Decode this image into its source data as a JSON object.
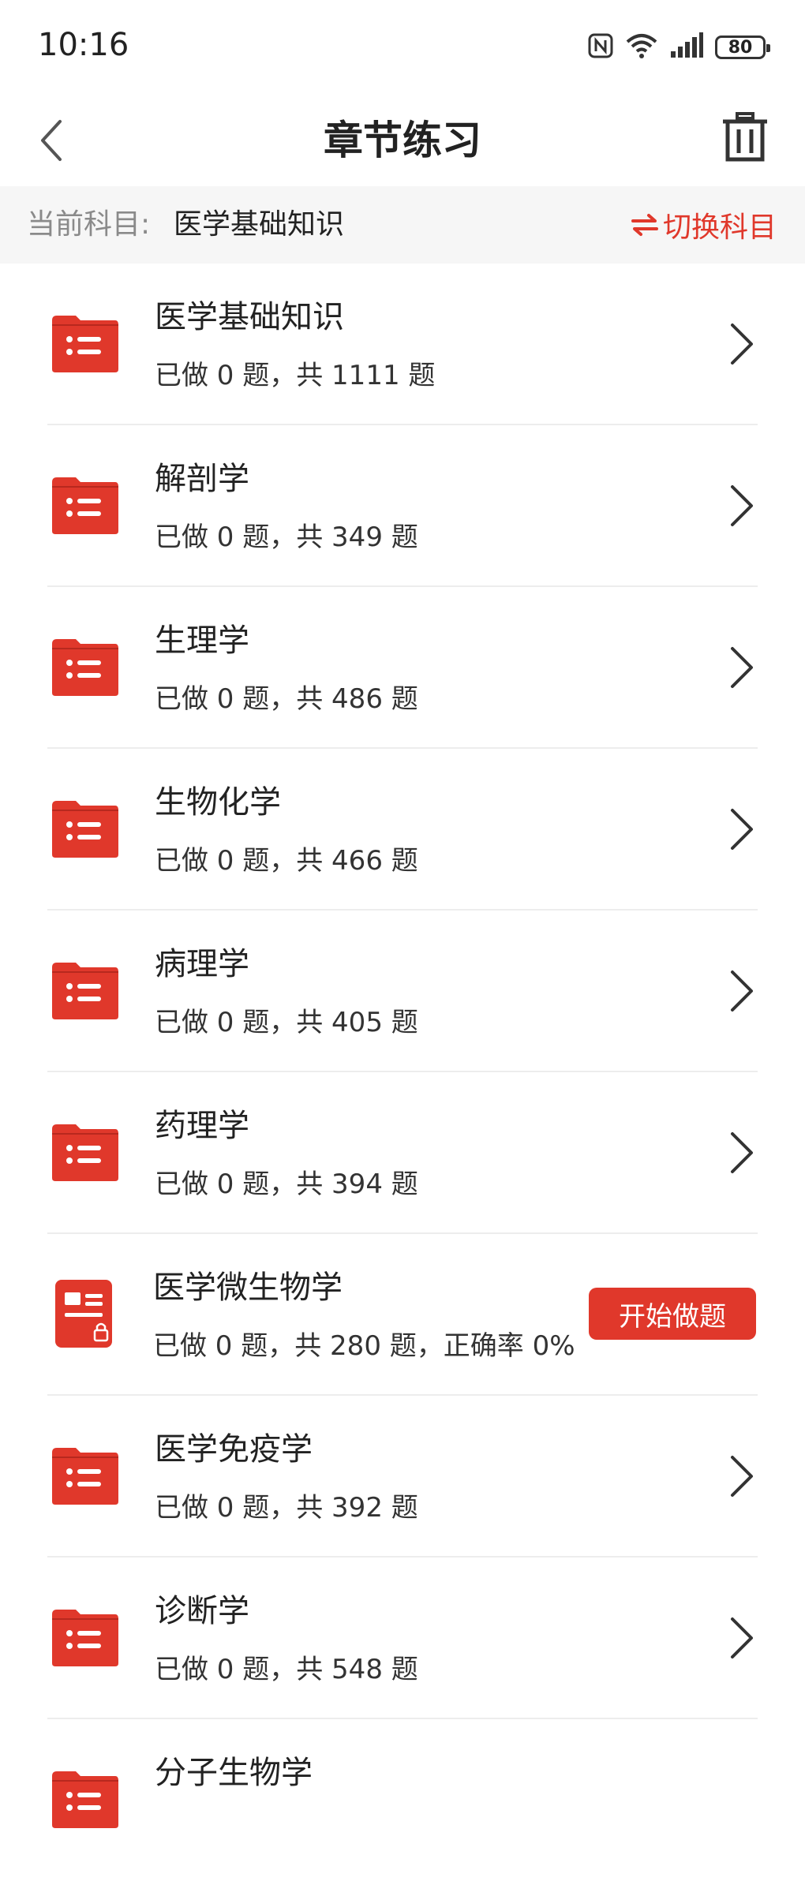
{
  "status_bar": {
    "time": "10:16",
    "battery": "80",
    "icons": [
      "nfc-icon",
      "wifi-icon",
      "signal-icon",
      "battery-icon"
    ]
  },
  "header": {
    "title": "章节练习",
    "back_icon": "chevron-left-icon",
    "trash_icon": "trash-icon"
  },
  "subject_bar": {
    "label": "当前科目:",
    "value": "医学基础知识",
    "switch_label": "切换科目",
    "switch_icon": "swap-icon"
  },
  "colors": {
    "accent": "#e0382b",
    "text": "#222222",
    "muted": "#8a8a8a",
    "bar_bg": "#f6f6f6"
  },
  "chapters": [
    {
      "title": "医学基础知识",
      "progress": "已做 0 题，共 1111 题",
      "type": "folder"
    },
    {
      "title": "解剖学",
      "progress": "已做 0 题，共 349 题",
      "type": "folder"
    },
    {
      "title": "生理学",
      "progress": "已做 0 题，共 486 题",
      "type": "folder"
    },
    {
      "title": "生物化学",
      "progress": "已做 0 题，共 466 题",
      "type": "folder"
    },
    {
      "title": "病理学",
      "progress": "已做 0 题，共 405 题",
      "type": "folder"
    },
    {
      "title": "药理学",
      "progress": "已做 0 题，共 394 题",
      "type": "folder"
    },
    {
      "title": "医学微生物学",
      "progress": "已做 0 题，共 280 题，正确率 0%",
      "type": "locked",
      "action": "开始做题"
    },
    {
      "title": "医学免疫学",
      "progress": "已做 0 题，共 392 题",
      "type": "folder"
    },
    {
      "title": "诊断学",
      "progress": "已做 0 题，共 548 题",
      "type": "folder"
    },
    {
      "title": "分子生物学",
      "progress": "",
      "type": "folder"
    }
  ]
}
